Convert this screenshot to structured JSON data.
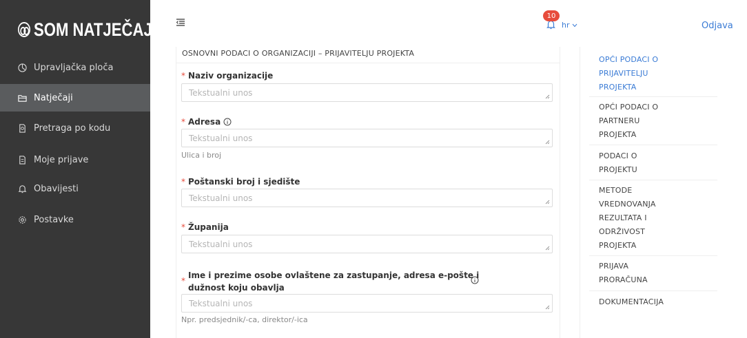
{
  "app": {
    "logo_text": "SOM NATJEČAJI"
  },
  "sidebar": {
    "items": [
      {
        "label": "Upravljačka ploča",
        "icon": "dashboard-icon"
      },
      {
        "label": "Natječaji",
        "icon": "folder-icon",
        "active": true
      },
      {
        "label": "Pretraga po kodu",
        "icon": "search-document-icon"
      },
      {
        "label": "Moje prijave",
        "icon": "document-icon"
      },
      {
        "label": "Obavijesti",
        "icon": "bell-icon"
      },
      {
        "label": "Postavke",
        "icon": "gear-icon"
      }
    ]
  },
  "header": {
    "notifications_count": "10",
    "language": "hr",
    "logout_label": "Odjava"
  },
  "form": {
    "section_title": "OSNOVNI PODACI O ORGANIZACIJI – PRIJAVITELJU PROJEKTA",
    "required_marker": "*",
    "fields": [
      {
        "label": "Naziv organizacije",
        "placeholder": "Tekstualni unos"
      },
      {
        "label": "Adresa",
        "placeholder": "Tekstualni unos",
        "hint": "Ulica i broj"
      },
      {
        "label": "Poštanski broj i sjedište",
        "placeholder": "Tekstualni unos"
      },
      {
        "label": "Županija",
        "placeholder": "Tekstualni unos"
      },
      {
        "label_line1": "Ime i prezime osobe ovlaštene za zastupanje, adresa e-pošte i",
        "label_line2": "dužnost koju obavlja",
        "placeholder": "Tekstualni unos",
        "hint": "Npr. predsjednik/-ca, direktor/-ica"
      }
    ]
  },
  "right_nav": {
    "items": [
      {
        "lines": [
          "OPĆI PODACI O",
          "PRIJAVITELJU",
          "PROJEKTA"
        ],
        "active": true
      },
      {
        "lines": [
          "OPĆI PODACI O",
          "PARTNERU",
          "PROJEKTA"
        ]
      },
      {
        "lines": [
          "PODACI O",
          "PROJEKTU"
        ]
      },
      {
        "lines": [
          "METODE",
          "VREDNOVANJA",
          "REZULTATA I",
          "ODRŽIVOST",
          "PROJEKTA"
        ]
      },
      {
        "lines": [
          "PRIJAVA",
          "PRORAČUNA"
        ]
      },
      {
        "lines": [
          "DOKUMENTACIJA"
        ]
      }
    ]
  },
  "colors": {
    "sidebar_bg": "#373737",
    "sidebar_active": "#5a5c5e",
    "accent": "#3a7bd5",
    "required": "#e74c3c"
  }
}
